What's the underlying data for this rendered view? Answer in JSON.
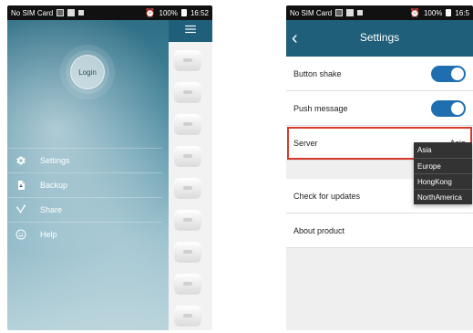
{
  "left": {
    "status": {
      "carrier": "No SIM Card",
      "battery": "100%",
      "time": "16:52"
    },
    "login_label": "Login",
    "menu": [
      {
        "label": "Settings",
        "icon": "gear-icon"
      },
      {
        "label": "Backup",
        "icon": "backup-icon"
      },
      {
        "label": "Share",
        "icon": "share-icon"
      },
      {
        "label": "Help",
        "icon": "help-icon"
      }
    ]
  },
  "right": {
    "status": {
      "carrier": "No SIM Card",
      "battery": "100%",
      "time": "16:5"
    },
    "title": "Settings",
    "rows": {
      "button_shake": "Button shake",
      "push_message": "Push message",
      "server_label": "Server",
      "server_value": "Asia",
      "check_updates": "Check for updates",
      "about_product": "About product"
    },
    "server_options": [
      "Asia",
      "Europe",
      "HongKong",
      "NorthAmerica"
    ]
  }
}
